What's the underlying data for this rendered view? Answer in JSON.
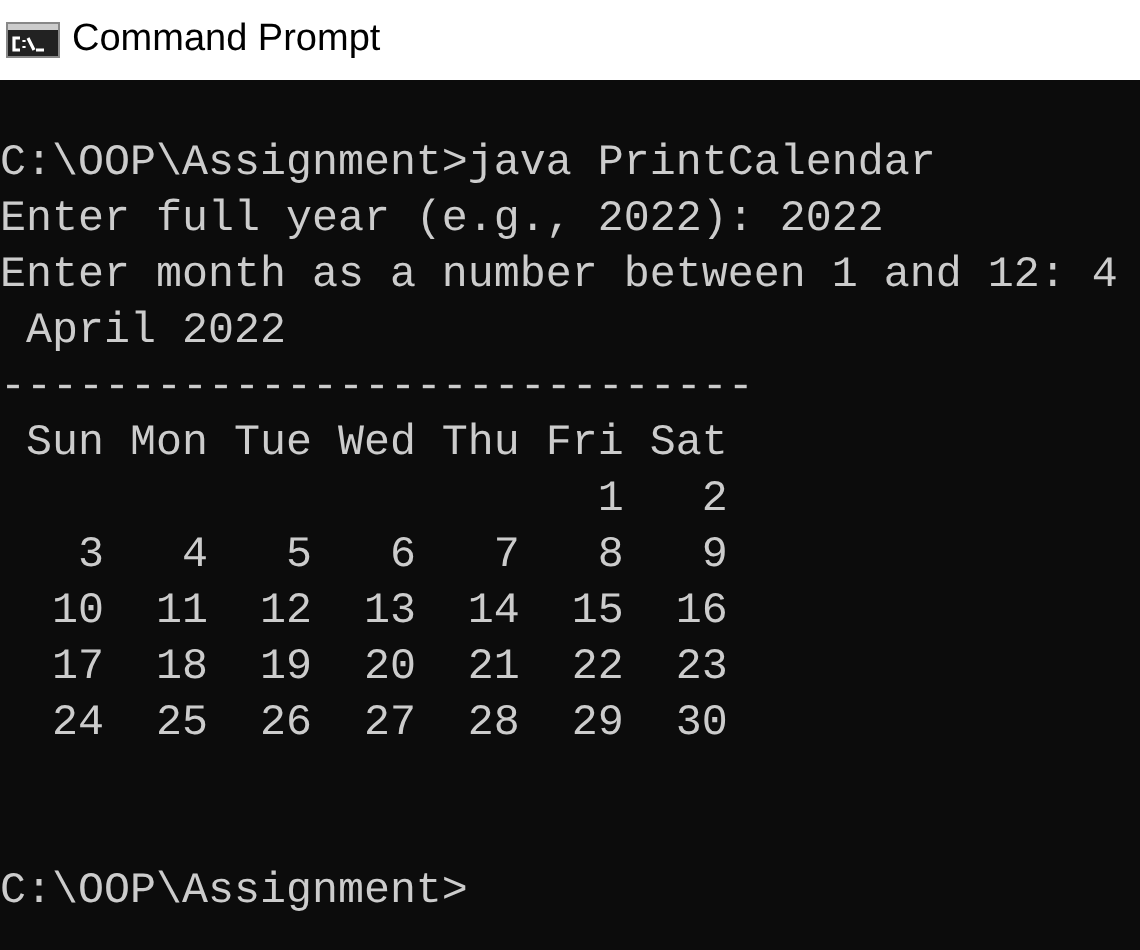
{
  "window": {
    "title": "Command Prompt"
  },
  "console": {
    "blocks": [
      [
        "C:\\OOP\\Assignment>java PrintCalendar",
        "Enter full year (e.g., 2022): 2022",
        "Enter month as a number between 1 and 12: 4",
        " April 2022",
        "-----------------------------",
        " Sun Mon Tue Wed Thu Fri Sat",
        "                       1   2",
        "   3   4   5   6   7   8   9",
        "  10  11  12  13  14  15  16",
        "  17  18  19  20  21  22  23",
        "  24  25  26  27  28  29  30"
      ],
      [
        "C:\\OOP\\Assignment>"
      ]
    ]
  }
}
